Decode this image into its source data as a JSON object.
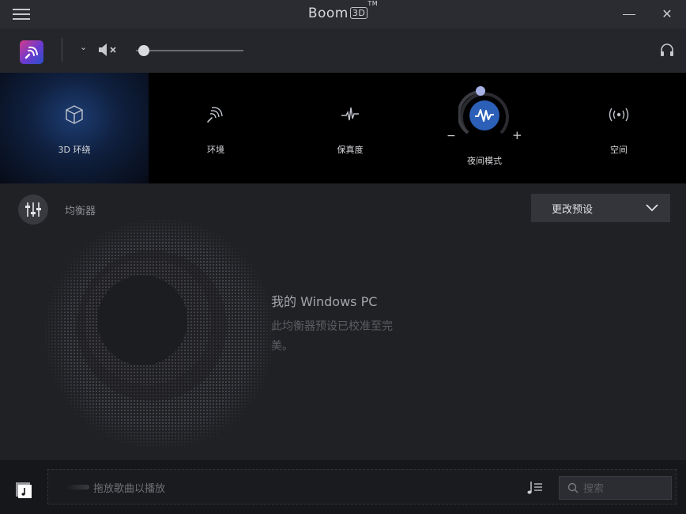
{
  "titlebar": {
    "app_name": "Boom",
    "badge": "3D",
    "trademark": "TM"
  },
  "toolbar": {
    "volume_percent": 7
  },
  "effects": [
    {
      "label": "3D 环绕",
      "icon": "cube-icon"
    },
    {
      "label": "环境",
      "icon": "waves-icon"
    },
    {
      "label": "保真度",
      "icon": "pulse-icon"
    },
    {
      "label": "夜间模式",
      "icon": "soundwave-icon"
    },
    {
      "label": "空间",
      "icon": "broadcast-icon"
    }
  ],
  "night_mode": {
    "minus": "−",
    "plus": "+"
  },
  "equalizer": {
    "label": "均衡器",
    "preset_label": "更改预设",
    "device_title": "我的 Windows PC",
    "description": "此均衡器预设已校准至完美。"
  },
  "bottom": {
    "drop_text": "拖放歌曲以播放",
    "search_placeholder": "搜索"
  },
  "colors": {
    "accent": "#2c5fb8",
    "knob": "#a7b2e6",
    "selected_tile": "#1d3d73"
  }
}
